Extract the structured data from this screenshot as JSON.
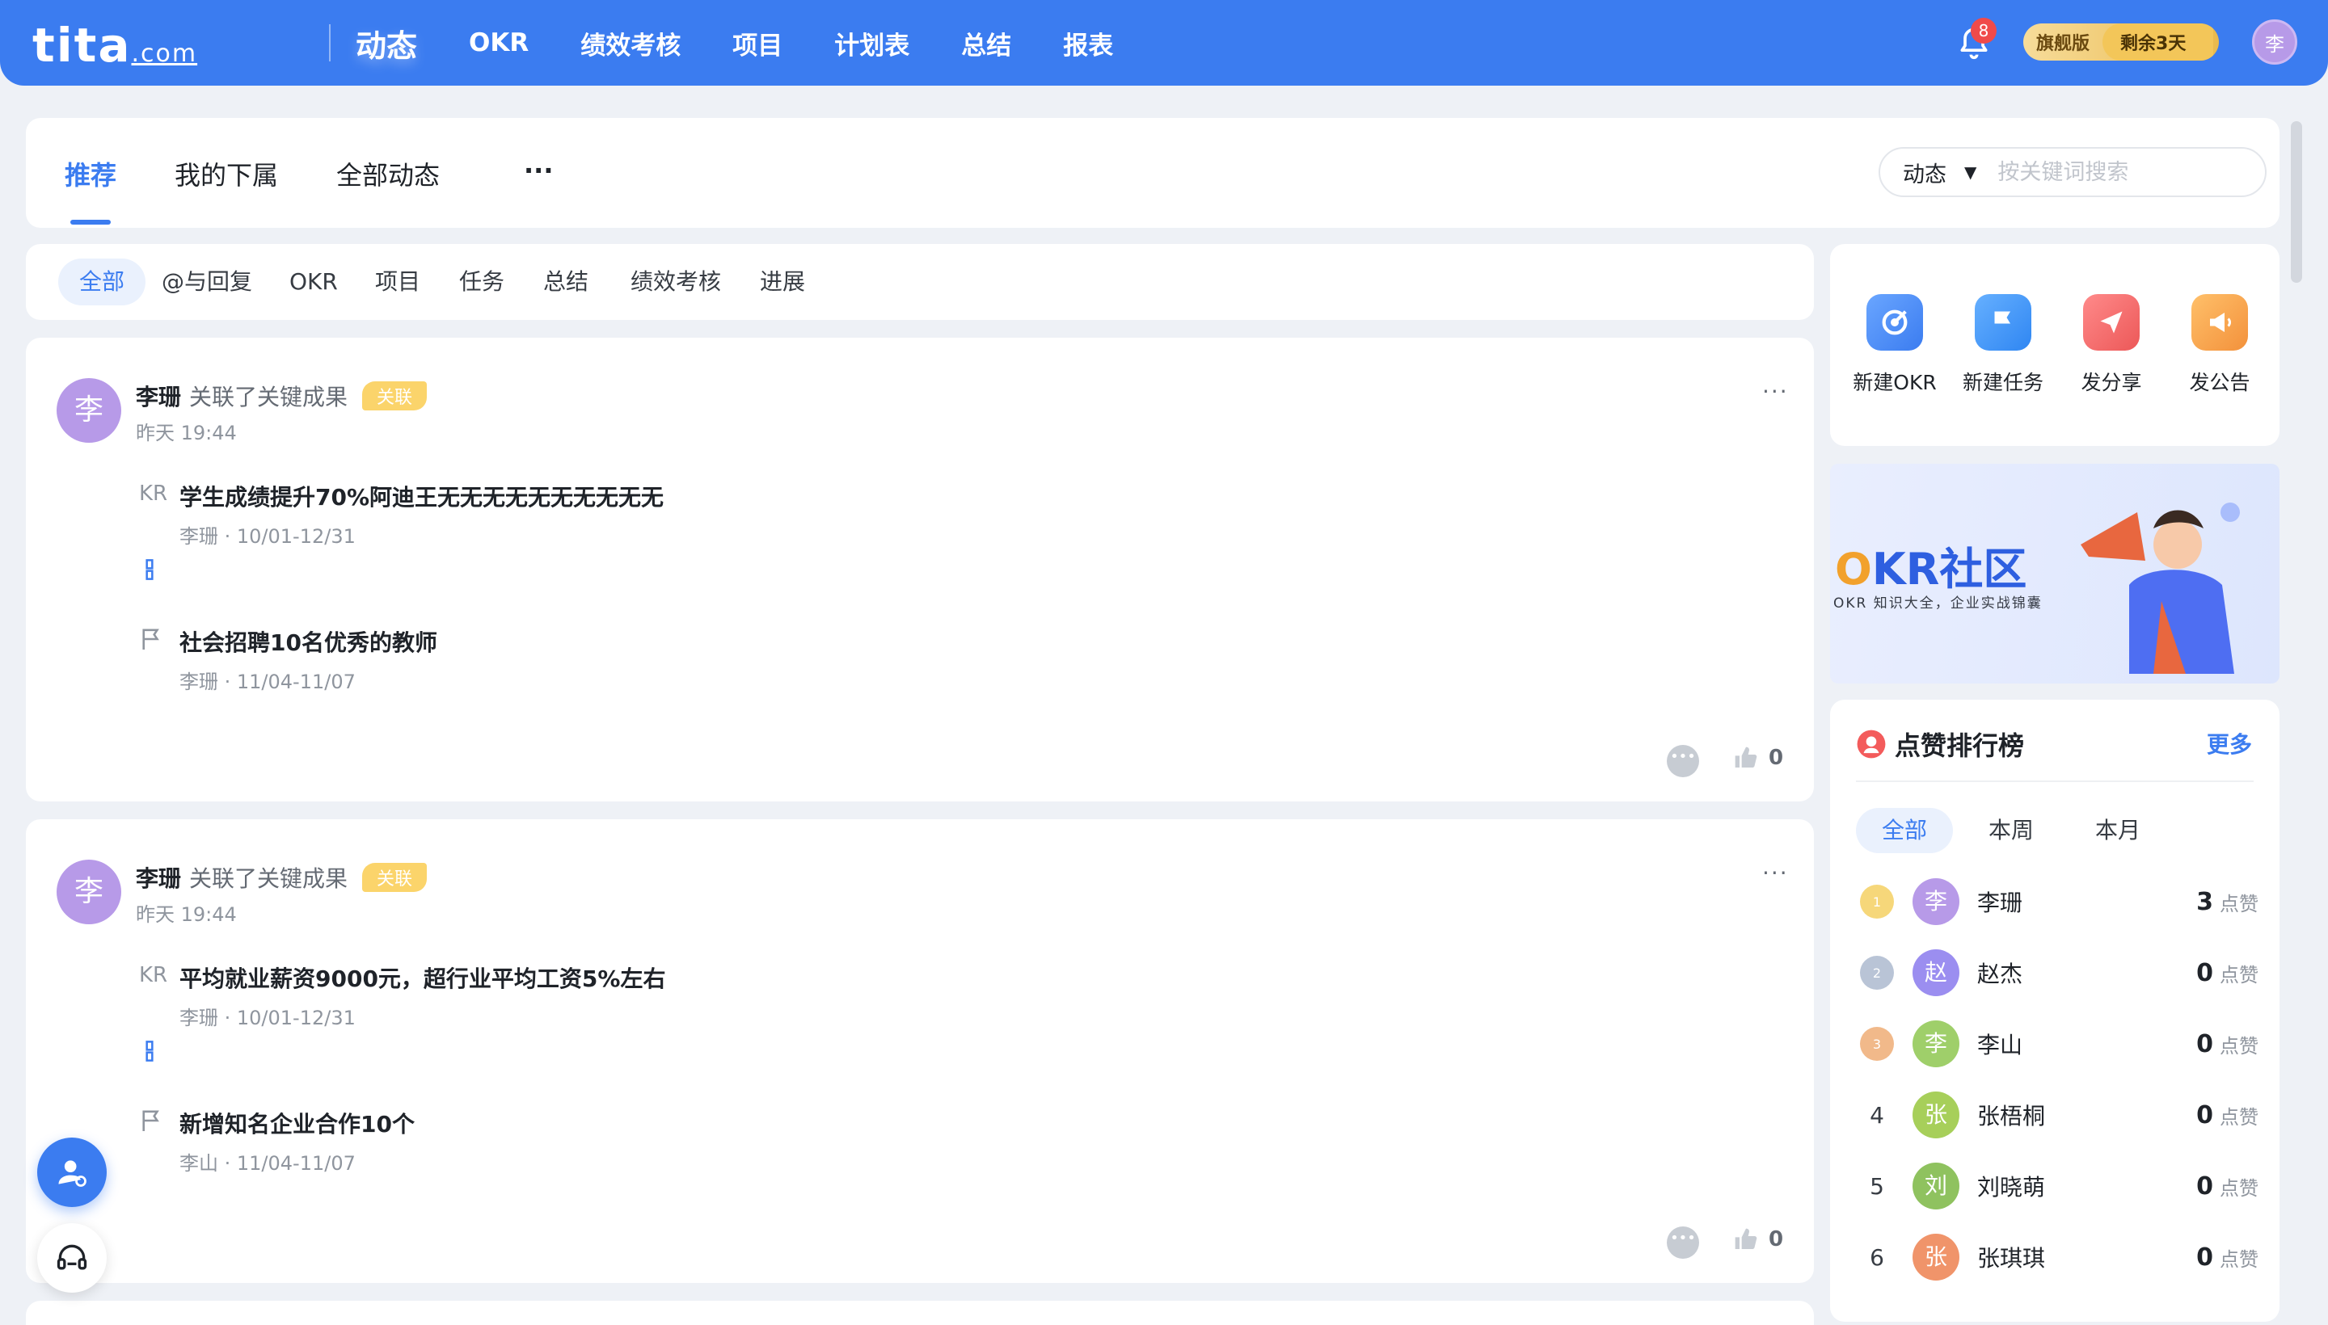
{
  "header": {
    "logo": "tita",
    "logo_suffix": ".com",
    "nav": [
      "动态",
      "OKR",
      "绩效考核",
      "项目",
      "计划表",
      "总结",
      "报表"
    ],
    "notification_count": "8",
    "plan_name": "旗舰版",
    "plan_remaining": "剩余3天",
    "user_avatar": "李"
  },
  "main_tabs": [
    "推荐",
    "我的下属",
    "全部动态",
    "···"
  ],
  "search": {
    "type": "动态",
    "placeholder": "按关键词搜索"
  },
  "filters": [
    "全部",
    "@与回复",
    "OKR",
    "项目",
    "任务",
    "总结",
    "绩效考核",
    "进展"
  ],
  "feed": [
    {
      "avatar": "李",
      "user": "李珊",
      "action": "关联了关键成果",
      "tag": "关联",
      "time": "昨天 19:44",
      "more": "···",
      "kr_label": "KR",
      "kr_title": "学生成绩提升70%阿迪王无无无无无无无无无无",
      "kr_meta": "李珊 · 10/01-12/31",
      "task_title": "社会招聘10名优秀的教师",
      "task_meta": "李珊 · 11/04-11/07",
      "likes": "0"
    },
    {
      "avatar": "李",
      "user": "李珊",
      "action": "关联了关键成果",
      "tag": "关联",
      "time": "昨天 19:44",
      "more": "···",
      "kr_label": "KR",
      "kr_title": "平均就业薪资9000元，超行业平均工资5%左右",
      "kr_meta": "李珊 · 10/01-12/31",
      "task_title": "新增知名企业合作10个",
      "task_meta": "李山 · 11/04-11/07",
      "likes": "0"
    }
  ],
  "quick_actions": [
    {
      "label": "新建OKR",
      "icon": "target-icon",
      "color": "#4a86f5"
    },
    {
      "label": "新建任务",
      "icon": "flag-icon",
      "color": "#3f8ff7"
    },
    {
      "label": "发分享",
      "icon": "paper-plane-icon",
      "color": "#f06a6a"
    },
    {
      "label": "发公告",
      "icon": "megaphone-icon",
      "color": "#f5a04a"
    }
  ],
  "banner": {
    "title_prefix": "O",
    "title": "KR社区",
    "subtitle": "OKR 知识大全，企业实战锦囊"
  },
  "ranking": {
    "title": "点赞排行榜",
    "more": "更多",
    "tabs": [
      "全部",
      "本周",
      "本月"
    ],
    "unit": "点赞",
    "rows": [
      {
        "rank": "1",
        "avatar": "李",
        "name": "李珊",
        "count": "3",
        "avatar_color": "#b79ae8",
        "medal": "gold"
      },
      {
        "rank": "2",
        "avatar": "赵",
        "name": "赵杰",
        "count": "0",
        "avatar_color": "#9b8ef0",
        "medal": "silver"
      },
      {
        "rank": "3",
        "avatar": "李",
        "name": "李山",
        "count": "0",
        "avatar_color": "#9fcf6a",
        "medal": "bronze"
      },
      {
        "rank": "4",
        "avatar": "张",
        "name": "张梧桐",
        "count": "0",
        "avatar_color": "#a7cf5a"
      },
      {
        "rank": "5",
        "avatar": "刘",
        "name": "刘晓萌",
        "count": "0",
        "avatar_color": "#8fc25f"
      },
      {
        "rank": "6",
        "avatar": "张",
        "name": "张琪琪",
        "count": "0",
        "avatar_color": "#f0946a"
      }
    ]
  }
}
